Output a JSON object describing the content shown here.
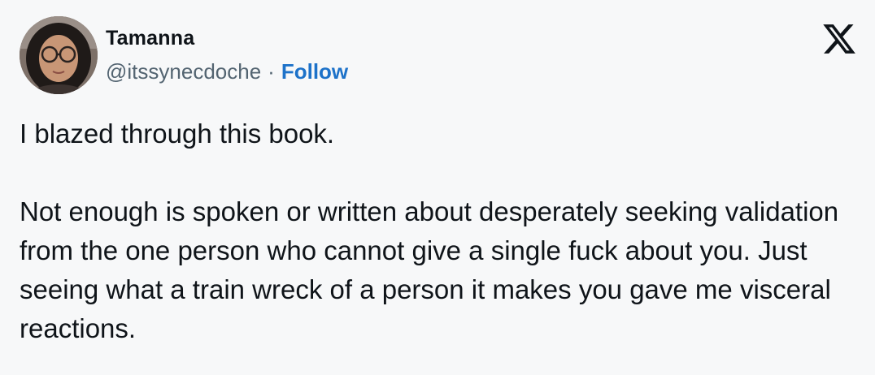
{
  "author": {
    "name": "Tamanna",
    "handle": "@itssynecdoche",
    "separator": "·",
    "follow_label": "Follow"
  },
  "icons": {
    "avatar": "profile-photo",
    "logo": "x-logo-icon"
  },
  "colors": {
    "background": "#f7f8f9",
    "text": "#0f1419",
    "secondary_text": "#536471",
    "follow_link": "#1d72c9"
  },
  "tweet": {
    "paragraphs": [
      "I blazed through this book.",
      "Not enough is spoken or written about desperately seeking validation from the one person who cannot give a single fuck about you. Just seeing what a train wreck of a person it makes you gave me visceral reactions."
    ]
  }
}
